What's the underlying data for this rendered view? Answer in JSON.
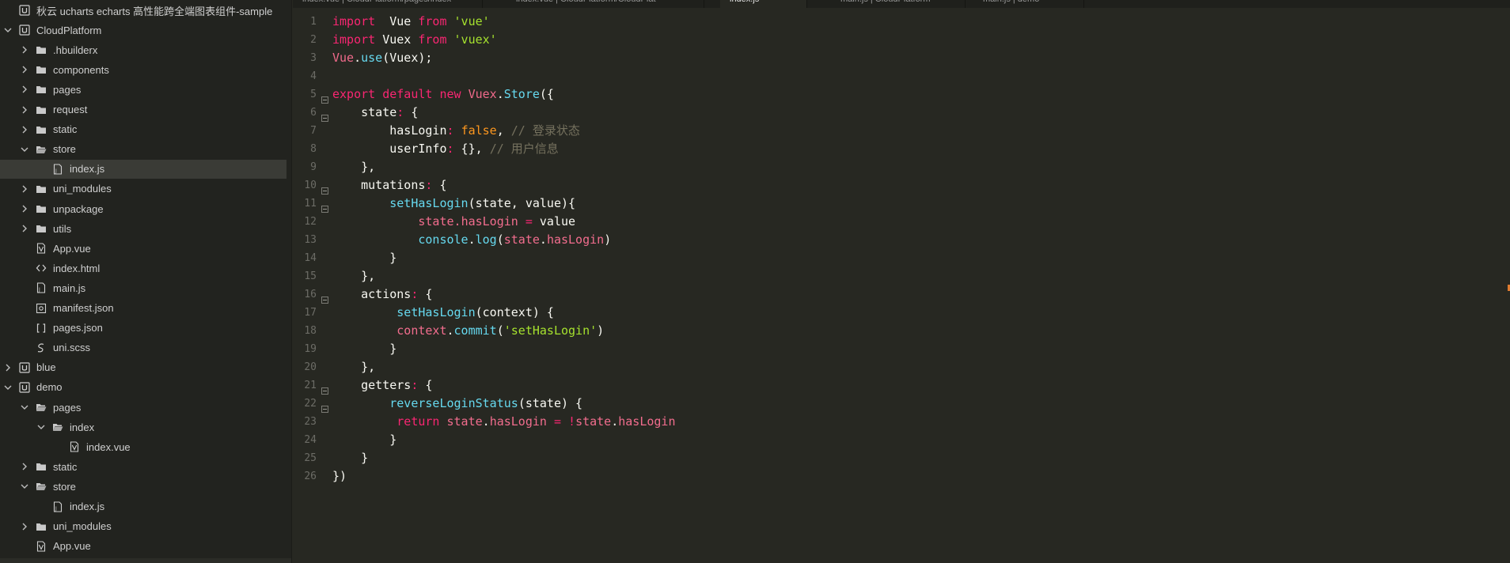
{
  "sidebar": {
    "items": [
      {
        "label": "秋云 ucharts echarts 高性能跨全端图表组件-sample",
        "indent": 0,
        "chevron": "none",
        "icon": "project-icon"
      },
      {
        "label": "CloudPlatform",
        "indent": 0,
        "chevron": "down",
        "icon": "project-icon"
      },
      {
        "label": ".hbuilderx",
        "indent": 1,
        "chevron": "right",
        "icon": "folder-icon"
      },
      {
        "label": "components",
        "indent": 1,
        "chevron": "right",
        "icon": "folder-icon"
      },
      {
        "label": "pages",
        "indent": 1,
        "chevron": "right",
        "icon": "folder-icon"
      },
      {
        "label": "request",
        "indent": 1,
        "chevron": "right",
        "icon": "folder-icon"
      },
      {
        "label": "static",
        "indent": 1,
        "chevron": "right",
        "icon": "folder-icon"
      },
      {
        "label": "store",
        "indent": 1,
        "chevron": "down",
        "icon": "folder-open-icon"
      },
      {
        "label": "index.js",
        "indent": 2,
        "chevron": "none",
        "icon": "js-file-icon",
        "selected": true
      },
      {
        "label": "uni_modules",
        "indent": 1,
        "chevron": "right",
        "icon": "folder-icon"
      },
      {
        "label": "unpackage",
        "indent": 1,
        "chevron": "right",
        "icon": "folder-icon"
      },
      {
        "label": "utils",
        "indent": 1,
        "chevron": "right",
        "icon": "folder-icon"
      },
      {
        "label": "App.vue",
        "indent": 1,
        "chevron": "none",
        "icon": "vue-file-icon"
      },
      {
        "label": "index.html",
        "indent": 1,
        "chevron": "none",
        "icon": "html-file-icon"
      },
      {
        "label": "main.js",
        "indent": 1,
        "chevron": "none",
        "icon": "js-file-icon"
      },
      {
        "label": "manifest.json",
        "indent": 1,
        "chevron": "none",
        "icon": "manifest-file-icon"
      },
      {
        "label": "pages.json",
        "indent": 1,
        "chevron": "none",
        "icon": "json-file-icon"
      },
      {
        "label": "uni.scss",
        "indent": 1,
        "chevron": "none",
        "icon": "scss-file-icon"
      },
      {
        "label": "blue",
        "indent": 0,
        "chevron": "right",
        "icon": "project-icon"
      },
      {
        "label": "demo",
        "indent": 0,
        "chevron": "down",
        "icon": "project-icon"
      },
      {
        "label": "pages",
        "indent": 1,
        "chevron": "down",
        "icon": "folder-open-icon"
      },
      {
        "label": "index",
        "indent": 2,
        "chevron": "down",
        "icon": "folder-open-icon"
      },
      {
        "label": "index.vue",
        "indent": 3,
        "chevron": "none",
        "icon": "vue-file-icon"
      },
      {
        "label": "static",
        "indent": 1,
        "chevron": "right",
        "icon": "folder-icon"
      },
      {
        "label": "store",
        "indent": 1,
        "chevron": "down",
        "icon": "folder-open-icon"
      },
      {
        "label": "index.js",
        "indent": 2,
        "chevron": "none",
        "icon": "js-file-icon"
      },
      {
        "label": "uni_modules",
        "indent": 1,
        "chevron": "right",
        "icon": "folder-icon"
      },
      {
        "label": "App.vue",
        "indent": 1,
        "chevron": "none",
        "icon": "vue-file-icon"
      }
    ]
  },
  "tabs": [
    {
      "label": "index.vue | CloudPlatform/pages/index",
      "active": false
    },
    {
      "label": "index.vue | CloudPlatform/CloudPlat",
      "active": false
    },
    {
      "label": "index.js",
      "active": true
    },
    {
      "label": "main.js | CloudPlatform",
      "active": false
    },
    {
      "label": "main.js | demo",
      "active": false
    }
  ],
  "editor": {
    "lines": [
      {
        "n": "1",
        "fold": false,
        "tokens": [
          [
            "kw",
            "import"
          ],
          [
            "",
            "  "
          ],
          [
            "prop",
            "Vue"
          ],
          [
            "",
            ""
          ],
          [
            "kw",
            " from "
          ],
          [
            "str",
            "'vue'"
          ]
        ]
      },
      {
        "n": "2",
        "fold": false,
        "tokens": [
          [
            "kw",
            "import"
          ],
          [
            "",
            " "
          ],
          [
            "prop",
            "Vuex"
          ],
          [
            "kw",
            " from "
          ],
          [
            "str",
            "'vuex'"
          ]
        ]
      },
      {
        "n": "3",
        "fold": false,
        "tokens": [
          [
            "cls",
            "Vue"
          ],
          [
            "",
            "."
          ],
          [
            "fn",
            "use"
          ],
          [
            "",
            "(Vuex);"
          ]
        ]
      },
      {
        "n": "4",
        "fold": false,
        "tokens": []
      },
      {
        "n": "5",
        "fold": true,
        "tokens": [
          [
            "kw",
            "export default new "
          ],
          [
            "cls",
            "Vuex"
          ],
          [
            "",
            "."
          ],
          [
            "fn",
            "Store"
          ],
          [
            "",
            "({"
          ]
        ]
      },
      {
        "n": "6",
        "fold": true,
        "tokens": [
          [
            "",
            "    state"
          ],
          [
            "kw",
            ":"
          ],
          [
            "",
            " {"
          ]
        ]
      },
      {
        "n": "7",
        "fold": false,
        "tokens": [
          [
            "",
            "        hasLogin"
          ],
          [
            "kw",
            ":"
          ],
          [
            "",
            " "
          ],
          [
            "bool",
            "false"
          ],
          [
            "",
            ", "
          ],
          [
            "cmt",
            "// 登录状态"
          ]
        ]
      },
      {
        "n": "8",
        "fold": false,
        "tokens": [
          [
            "",
            "        userInfo"
          ],
          [
            "kw",
            ":"
          ],
          [
            "",
            " {}, "
          ],
          [
            "cmt",
            "// 用户信息"
          ]
        ]
      },
      {
        "n": "9",
        "fold": false,
        "tokens": [
          [
            "",
            "    },"
          ]
        ]
      },
      {
        "n": "10",
        "fold": true,
        "tokens": [
          [
            "",
            "    mutations"
          ],
          [
            "kw",
            ":"
          ],
          [
            "",
            " {"
          ]
        ]
      },
      {
        "n": "11",
        "fold": true,
        "tokens": [
          [
            "",
            "        "
          ],
          [
            "fn",
            "setHasLogin"
          ],
          [
            "",
            "(state, value){"
          ]
        ]
      },
      {
        "n": "12",
        "fold": false,
        "tokens": [
          [
            "",
            "            "
          ],
          [
            "pink",
            "state"
          ],
          [
            "pink",
            "."
          ],
          [
            "pink",
            "hasLogin"
          ],
          [
            "kw",
            " = "
          ],
          [
            "",
            "value"
          ]
        ]
      },
      {
        "n": "13",
        "fold": false,
        "tokens": [
          [
            "",
            "            "
          ],
          [
            "fn",
            "console"
          ],
          [
            "",
            "."
          ],
          [
            "fn",
            "log"
          ],
          [
            "",
            "("
          ],
          [
            "pink",
            "state"
          ],
          [
            "",
            "."
          ],
          [
            "pink",
            "hasLogin"
          ],
          [
            "",
            ")"
          ]
        ]
      },
      {
        "n": "14",
        "fold": false,
        "tokens": [
          [
            "",
            "        }"
          ]
        ]
      },
      {
        "n": "15",
        "fold": false,
        "tokens": [
          [
            "",
            "    },"
          ]
        ]
      },
      {
        "n": "16",
        "fold": true,
        "tokens": [
          [
            "",
            "    actions"
          ],
          [
            "kw",
            ":"
          ],
          [
            "",
            " {"
          ]
        ]
      },
      {
        "n": "17",
        "fold": false,
        "tokens": [
          [
            "",
            "         "
          ],
          [
            "fn",
            "setHasLogin"
          ],
          [
            "",
            "(context) {"
          ]
        ]
      },
      {
        "n": "18",
        "fold": false,
        "tokens": [
          [
            "",
            "         "
          ],
          [
            "pink",
            "context"
          ],
          [
            "",
            "."
          ],
          [
            "fn",
            "commit"
          ],
          [
            "",
            "("
          ],
          [
            "str",
            "'setHasLogin'"
          ],
          [
            "",
            ")"
          ]
        ]
      },
      {
        "n": "19",
        "fold": false,
        "tokens": [
          [
            "",
            "        }"
          ]
        ]
      },
      {
        "n": "20",
        "fold": false,
        "tokens": [
          [
            "",
            "    },"
          ]
        ]
      },
      {
        "n": "21",
        "fold": true,
        "tokens": [
          [
            "",
            "    getters"
          ],
          [
            "kw",
            ":"
          ],
          [
            "",
            " {"
          ]
        ]
      },
      {
        "n": "22",
        "fold": true,
        "tokens": [
          [
            "",
            "        "
          ],
          [
            "fn",
            "reverseLoginStatus"
          ],
          [
            "",
            "(state) {"
          ]
        ]
      },
      {
        "n": "23",
        "fold": false,
        "tokens": [
          [
            "",
            "         "
          ],
          [
            "kw",
            "return "
          ],
          [
            "pink",
            "state"
          ],
          [
            "",
            "."
          ],
          [
            "pink",
            "hasLogin"
          ],
          [
            "kw",
            " = !"
          ],
          [
            "pink",
            "state"
          ],
          [
            "",
            "."
          ],
          [
            "pink",
            "hasLogin"
          ]
        ]
      },
      {
        "n": "24",
        "fold": false,
        "tokens": [
          [
            "",
            "        }"
          ]
        ]
      },
      {
        "n": "25",
        "fold": false,
        "tokens": [
          [
            "",
            "    }"
          ]
        ]
      },
      {
        "n": "26",
        "fold": false,
        "tokens": [
          [
            "",
            "})"
          ]
        ]
      }
    ]
  }
}
